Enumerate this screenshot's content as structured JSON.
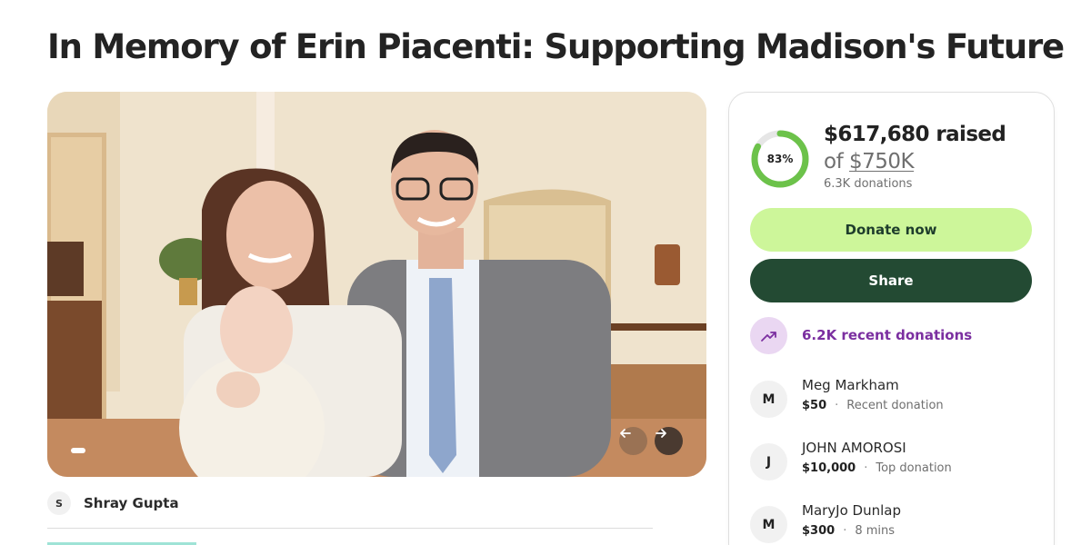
{
  "page": {
    "title": "In Memory of Erin Piacenti: Supporting Madison's Future"
  },
  "organizer": {
    "initial": "S",
    "name": "Shray Gupta"
  },
  "carousel": {
    "prev_icon": "arrow-left-icon",
    "next_icon": "arrow-right-icon"
  },
  "fundraiser": {
    "progress_percent": 83,
    "progress_label": "83%",
    "raised": "$617,680 raised",
    "goal_prefix": "of ",
    "goal": "$750K",
    "donations": "6.3K donations",
    "donate_label": "Donate now",
    "share_label": "Share",
    "recent_label": "6.2K recent donations"
  },
  "donors": [
    {
      "initial": "M",
      "name": "Meg Markham",
      "amount": "$50",
      "note": "Recent donation"
    },
    {
      "initial": "J",
      "name": "JOHN AMOROSI",
      "amount": "$10,000",
      "note": "Top donation"
    },
    {
      "initial": "M",
      "name": "MaryJo Dunlap",
      "amount": "$300",
      "note": "8 mins"
    }
  ],
  "colors": {
    "progress": "#6cc24a",
    "progress_track": "#e6e6e6",
    "donate_bg": "#cdf69a",
    "share_bg": "#234a33",
    "recent_accent": "#7b2fa0"
  }
}
